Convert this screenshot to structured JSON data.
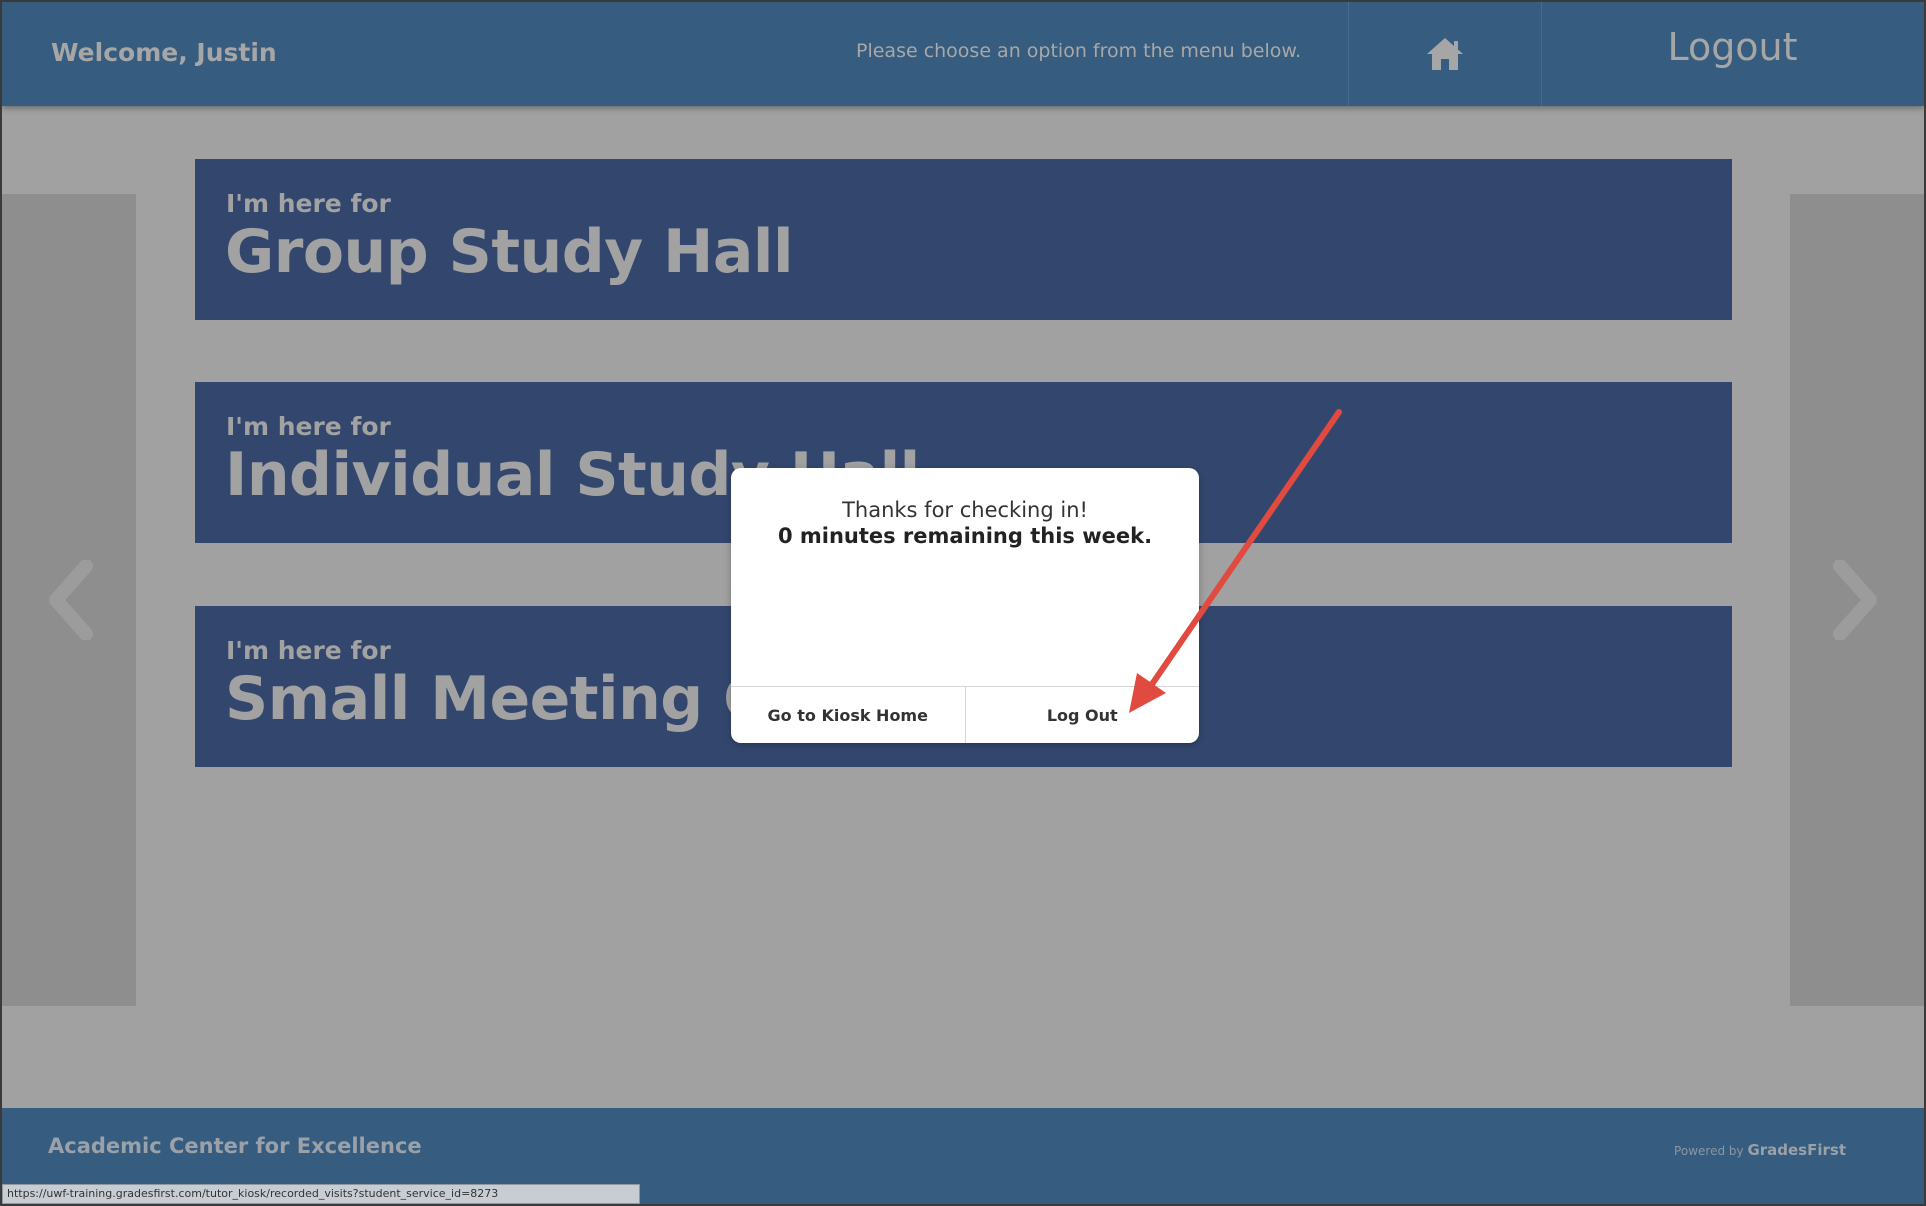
{
  "header": {
    "welcome": "Welcome, Justin",
    "instructions": "Please choose an option from the menu below.",
    "home_icon": "home-icon",
    "logout_label": "Logout"
  },
  "options": [
    {
      "prefix": "I'm here for",
      "title": "Group Study Hall"
    },
    {
      "prefix": "I'm here for",
      "title": "Individual Study Hall"
    },
    {
      "prefix": "I'm here for",
      "title": "Small Meeting Group"
    }
  ],
  "carousel": {
    "prev_icon": "chevron-left-icon",
    "next_icon": "chevron-right-icon"
  },
  "modal": {
    "message": "Thanks for checking in!",
    "remaining": "0 minutes remaining this week.",
    "kiosk_home_label": "Go to Kiosk Home",
    "logout_label": "Log Out"
  },
  "footer": {
    "org": "Academic Center for Excellence",
    "powered_prefix": "Powered by",
    "powered_brand": "GradesFirst"
  },
  "status_bar": {
    "url": "https://uwf-training.gradesfirst.com/tutor_kiosk/recorded_visits?student_service_id=8273"
  },
  "colors": {
    "header_bg": "#365c7f",
    "card_bg": "#33476e",
    "overlay_bg": "#a1a1a1",
    "annotation_arrow": "#e04a3f"
  }
}
